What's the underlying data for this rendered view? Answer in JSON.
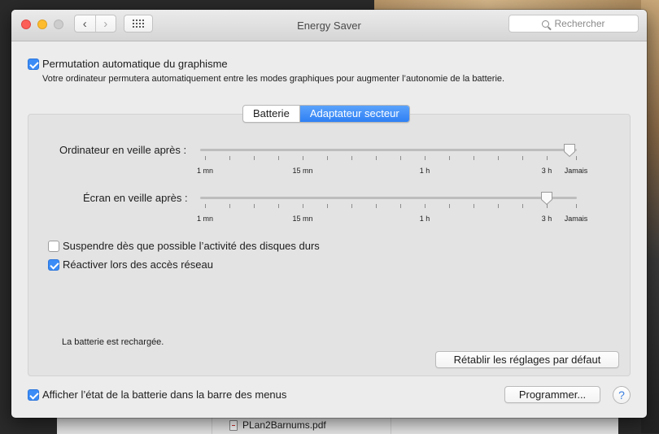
{
  "window": {
    "title": "Energy Saver",
    "search_placeholder": "Rechercher"
  },
  "graphics_switching": {
    "checked": true,
    "label": "Permutation automatique du graphisme",
    "description": "Votre ordinateur permutera automatiquement entre les modes graphiques pour augmenter l’autonomie de la batterie."
  },
  "tabs": [
    {
      "label": "Batterie",
      "active": false
    },
    {
      "label": "Adaptateur secteur",
      "active": true
    }
  ],
  "computer_sleep": {
    "label": "Ordinateur en veille après :",
    "value_fraction": 0.98
  },
  "display_sleep": {
    "label": "Écran en veille après :",
    "value_fraction": 0.92
  },
  "slider_scale": {
    "labels": [
      "1 mn",
      "15 mn",
      "1 h",
      "3 h",
      "Jamais"
    ]
  },
  "options": [
    {
      "checked": false,
      "label": "Suspendre dès que possible l’activité des disques durs"
    },
    {
      "checked": true,
      "label": "Réactiver lors des accès réseau"
    }
  ],
  "battery_status": "La batterie est rechargée.",
  "restore_defaults_label": "Rétablir les réglages par défaut",
  "menu_bar_battery": {
    "checked": true,
    "label": "Afficher l’état de la batterie dans la barre des menus"
  },
  "schedule_label": "Programmer...",
  "help_label": "?",
  "background_file": "PLan2Barnums.pdf"
}
